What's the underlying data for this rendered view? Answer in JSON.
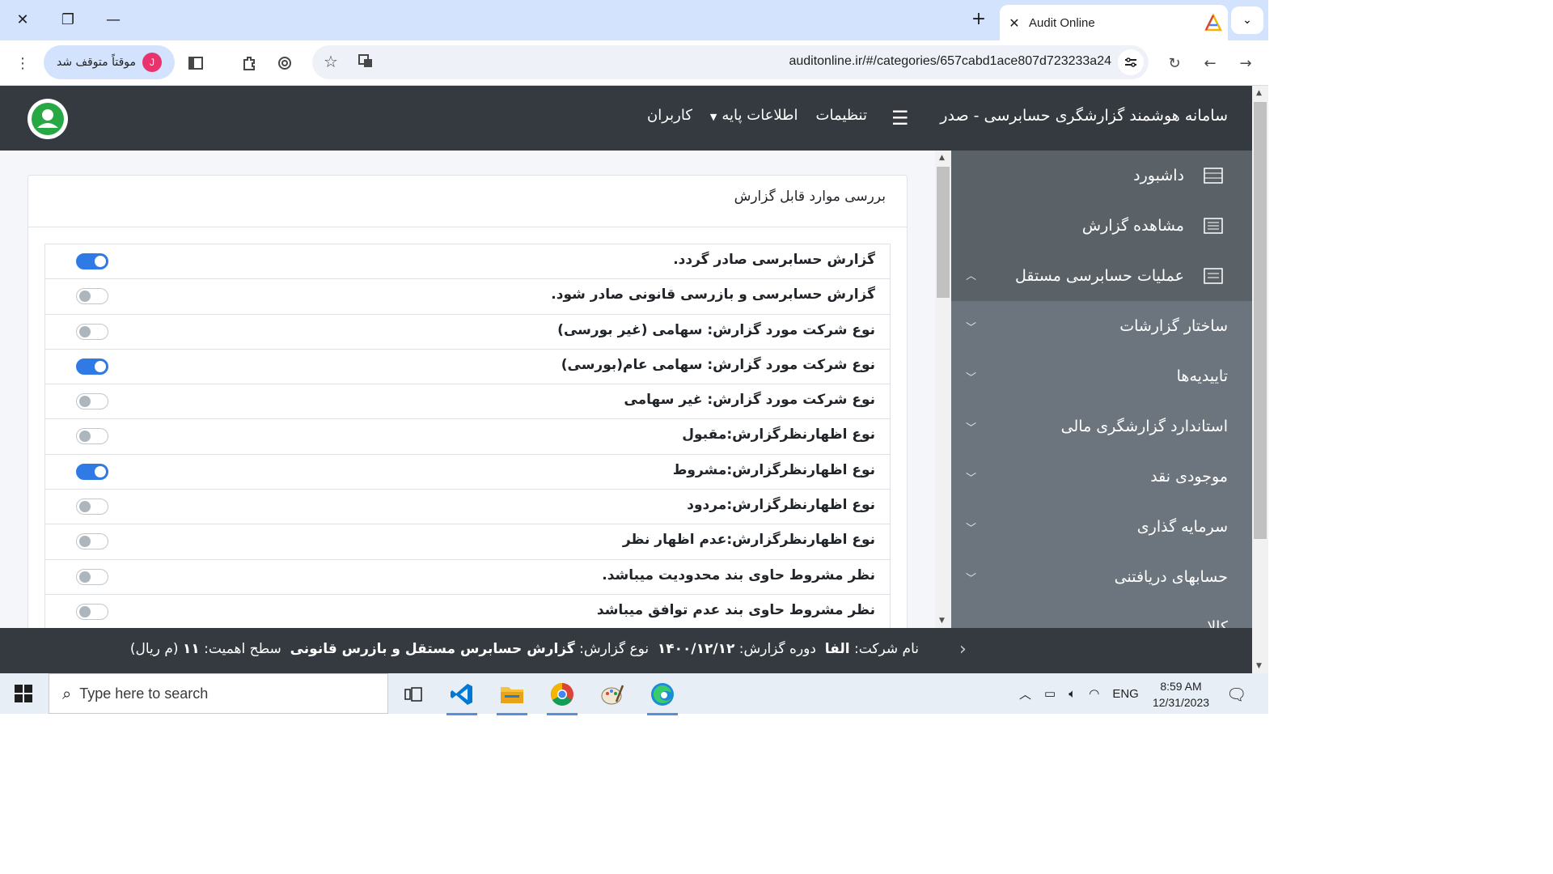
{
  "browser": {
    "tab_title": "Audit Online",
    "url": "auditonline.ir/#/categories/657cabd1ace807d723233a24",
    "profile_initial": "J",
    "profile_status": "موقتاً متوقف شد"
  },
  "header": {
    "app_title": "سامانه هوشمند گزارشگری حسابرسی - صدر",
    "nav": {
      "settings": "تنظیمات",
      "base_info": "اطلاعات پایه",
      "users": "کاربران"
    }
  },
  "sidebar": {
    "items": [
      {
        "label": "داشبورد",
        "icon": "table-icon"
      },
      {
        "label": "مشاهده گزارش",
        "icon": "list-icon"
      },
      {
        "label": "عملیات حسابرسی مستقل",
        "icon": "document-icon"
      }
    ],
    "subitems": [
      {
        "label": "ساختار گزارشات"
      },
      {
        "label": "تاییدیه‌ها"
      },
      {
        "label": "استاندارد گزارشگری مالی"
      },
      {
        "label": "موجودی نقد"
      },
      {
        "label": "سرمایه گذاری"
      },
      {
        "label": "حسابهای دریافتنی"
      },
      {
        "label": "کالا"
      }
    ]
  },
  "card": {
    "title": "بررسی موارد قابل گزارش",
    "rows": [
      {
        "label": "گزارش حسابرسی صادر گردد.",
        "on": true
      },
      {
        "label": "گزارش حسابرسی و بازرسی قانونی صادر شود.",
        "on": false
      },
      {
        "label": "نوع شرکت مورد گزارش: سهامی (غیر بورسی)",
        "on": false
      },
      {
        "label": "نوع شرکت مورد گزارش: سهامی عام(بورسی)",
        "on": true
      },
      {
        "label": "نوع شرکت مورد گزارش: غیر سهامی",
        "on": false
      },
      {
        "label": "نوع اظهارنظرگزارش:مقبول",
        "on": false
      },
      {
        "label": "نوع اظهارنظرگزارش:مشروط",
        "on": true
      },
      {
        "label": "نوع اظهارنظرگزارش:مردود",
        "on": false
      },
      {
        "label": "نوع اظهارنظرگزارش:عدم اظهار نظر",
        "on": false
      },
      {
        "label": "نظر مشروط حاوی بند محدودیت میباشد.",
        "on": false
      },
      {
        "label": "نظر مشروط حاوی بند عدم توافق میباشد",
        "on": false
      }
    ]
  },
  "footer": {
    "company_label": "نام شرکت:",
    "company_value": "الفا",
    "period_label": "دوره گزارش:",
    "period_value": "۱۴۰۰/۱۲/۱۲",
    "type_label": "نوع گزارش:",
    "type_value": "گزارش حسابرس مستقل و بازرس قانونی",
    "materiality_label": "سطح اهمیت:",
    "materiality_value": "۱۱",
    "materiality_unit": "(م ریال)"
  },
  "taskbar": {
    "search_placeholder": "Type here to search",
    "language": "ENG",
    "time": "8:59 AM",
    "date": "12/31/2023"
  },
  "colors": {
    "header_bg": "#343a40",
    "sidebar_bg": "#6c757d",
    "toggle_on": "#2f7ae5"
  }
}
